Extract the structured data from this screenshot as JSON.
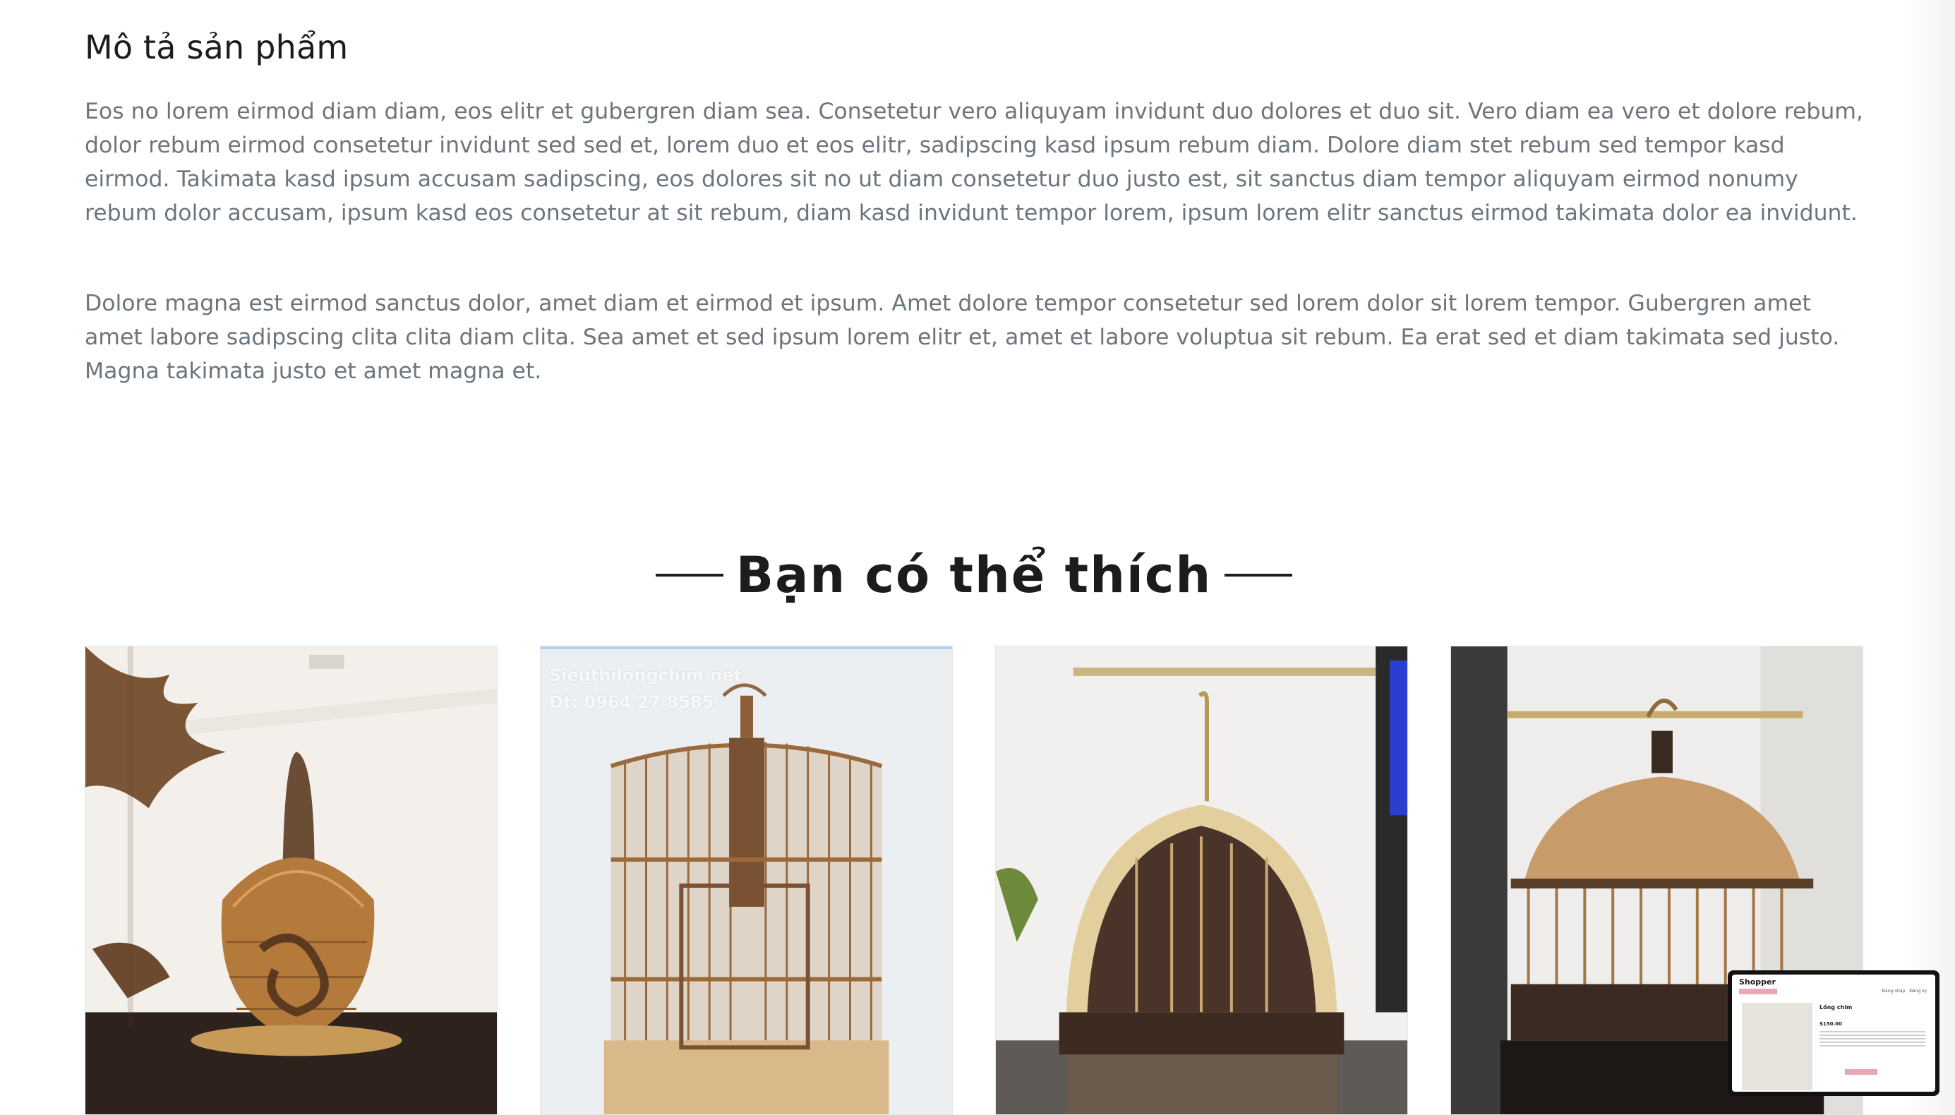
{
  "description": {
    "title": "Mô tả sản phẩm",
    "paragraphs": [
      "Eos no lorem eirmod diam diam, eos elitr et gubergren diam sea. Consetetur vero aliquyam invidunt duo dolores et duo sit. Vero diam ea vero et dolore rebum, dolor rebum eirmod consetetur invidunt sed sed et, lorem duo et eos elitr, sadipscing kasd ipsum rebum diam. Dolore diam stet rebum sed tempor kasd eirmod. Takimata kasd ipsum accusam sadipscing, eos dolores sit no ut diam consetetur duo justo est, sit sanctus diam tempor aliquyam eirmod nonumy rebum dolor accusam, ipsum kasd eos consetetur at sit rebum, diam kasd invidunt tempor lorem, ipsum lorem elitr sanctus eirmod takimata dolor ea invidunt.",
      "Dolore magna est eirmod sanctus dolor, amet diam et eirmod et ipsum. Amet dolore tempor consetetur sed lorem dolor sit lorem tempor. Gubergren amet amet labore sadipscing clita clita diam clita. Sea amet et sed ipsum lorem elitr et, amet et labore voluptua sit rebum. Ea erat sed et diam takimata sed justo. Magna takimata justo et amet magna et."
    ]
  },
  "related": {
    "title": "Bạn có thể thích",
    "products": [
      {
        "image": "dragon-teardrop-bamboo-birdcage"
      },
      {
        "image": "round-bamboo-birdcage",
        "watermark": [
          "Sieuthilongchim.net",
          "Đt: 0964 27 8585"
        ]
      },
      {
        "image": "arched-carved-birdcage"
      },
      {
        "image": "dome-wooden-birdcage"
      }
    ]
  },
  "preview": {
    "logo": "Shopper",
    "nav": [
      "Đăng nhập",
      "Đăng ký"
    ],
    "title": "Lồng chim",
    "price": "$150.00"
  }
}
